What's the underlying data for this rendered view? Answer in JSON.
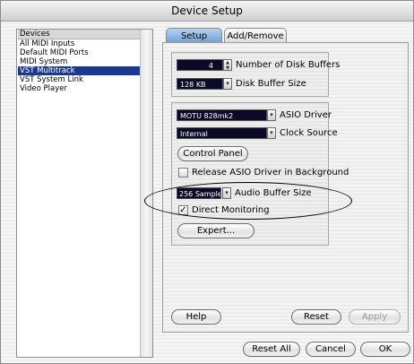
{
  "window": {
    "title": "Device Setup"
  },
  "sidebar": {
    "items": [
      {
        "label": "Devices",
        "header": true
      },
      {
        "label": "All MIDI Inputs"
      },
      {
        "label": "Default MIDI Ports"
      },
      {
        "label": "MIDI System"
      },
      {
        "label": "VST Multitrack",
        "selected": true
      },
      {
        "label": "VST System Link"
      },
      {
        "label": "Video Player"
      }
    ]
  },
  "tabs": [
    {
      "label": "Setup",
      "active": true
    },
    {
      "label": "Add/Remove",
      "active": false
    }
  ],
  "setup": {
    "disk_buffers_value": "4",
    "disk_buffers_label": "Number of Disk Buffers",
    "disk_buffer_size_value": "128 KB",
    "disk_buffer_size_label": "Disk Buffer Size",
    "asio_driver_value": "MOTU 828mk2",
    "asio_driver_label": "ASIO Driver",
    "clock_source_value": "Internal",
    "clock_source_label": "Clock Source",
    "control_panel_label": "Control Panel",
    "release_driver_label": "Release ASIO Driver in Background",
    "release_driver_checked": false,
    "audio_buffer_value": "256 Samples",
    "audio_buffer_label": "Audio Buffer Size",
    "direct_monitoring_label": "Direct Monitoring",
    "direct_monitoring_checked": true,
    "expert_label": "Expert..."
  },
  "panel_buttons": {
    "help": "Help",
    "reset": "Reset",
    "apply": "Apply"
  },
  "footer": {
    "reset_all": "Reset All",
    "cancel": "Cancel",
    "ok": "OK"
  },
  "colors": {
    "selection": "#1c3a88",
    "field_bg": "#0a0a26",
    "active_tab": "#6ea0d4"
  }
}
